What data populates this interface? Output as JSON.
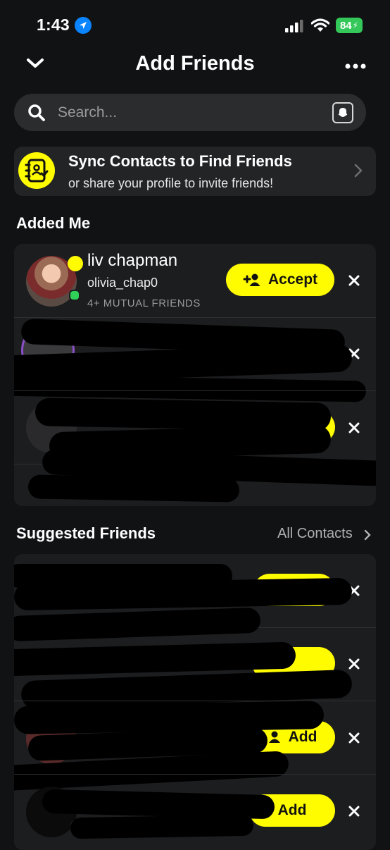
{
  "status_bar": {
    "time": "1:43",
    "battery": "84"
  },
  "header": {
    "title": "Add Friends"
  },
  "search": {
    "placeholder": "Search..."
  },
  "sync_card": {
    "title": "Sync Contacts to Find Friends",
    "subtitle": "or share your profile to invite friends!"
  },
  "added_me": {
    "heading": "Added Me",
    "items": [
      {
        "name": "liv chapman",
        "username": "olivia_chap0",
        "mutual": "4+ MUTUAL FRIENDS",
        "action": "Accept"
      }
    ]
  },
  "suggested": {
    "heading": "Suggested Friends",
    "all_contacts": "All Contacts",
    "add_label": "Add"
  },
  "colors": {
    "background": "#111213",
    "accent_yellow": "#fffc00",
    "online_green": "#2fd158",
    "card": "#1c1d1f"
  }
}
